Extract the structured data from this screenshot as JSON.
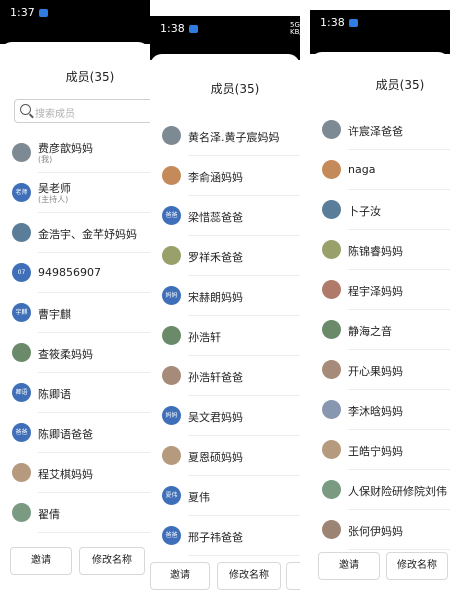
{
  "screens": [
    {
      "time": "1:37",
      "title": "成员(35)",
      "search_placeholder": "搜索成员",
      "buttons": [
        "邀请",
        "修改名称"
      ],
      "members": [
        {
          "name": "费彦歆妈妈",
          "sub": "(我)",
          "avatar": "",
          "kind": "photo"
        },
        {
          "name": "吴老师",
          "sub": "(主持人)",
          "avatar": "老师",
          "kind": "tag"
        },
        {
          "name": "金浩宇、金芊妤妈妈",
          "sub": "",
          "avatar": "",
          "kind": "photo"
        },
        {
          "name": "949856907",
          "sub": "",
          "avatar": "07",
          "kind": "tag"
        },
        {
          "name": "曹宇麒",
          "sub": "",
          "avatar": "宇麒",
          "kind": "tag"
        },
        {
          "name": "查筱柔妈妈",
          "sub": "",
          "avatar": "",
          "kind": "photo"
        },
        {
          "name": "陈卿语",
          "sub": "",
          "avatar": "卿语",
          "kind": "tag"
        },
        {
          "name": "陈卿语爸爸",
          "sub": "",
          "avatar": "爸爸",
          "kind": "tag"
        },
        {
          "name": "程艾棋妈妈",
          "sub": "",
          "avatar": "",
          "kind": "photo"
        },
        {
          "name": "翟倩",
          "sub": "",
          "avatar": "",
          "kind": "photo"
        }
      ]
    },
    {
      "time": "1:38",
      "title": "成员(35)",
      "status_right": [
        "5G",
        "KB/s"
      ],
      "buttons": [
        "邀请",
        "修改名称"
      ],
      "members": [
        {
          "name": "黄名泽.黄子宸妈妈",
          "avatar": "",
          "kind": "photo"
        },
        {
          "name": "李俞涵妈妈",
          "avatar": "",
          "kind": "photo"
        },
        {
          "name": "梁惜蕊爸爸",
          "avatar": "爸爸",
          "kind": "tag"
        },
        {
          "name": "罗祥禾爸爸",
          "avatar": "",
          "kind": "photo"
        },
        {
          "name": "宋赫朗妈妈",
          "avatar": "妈妈",
          "kind": "tag"
        },
        {
          "name": "孙浩轩",
          "avatar": "",
          "kind": "photo"
        },
        {
          "name": "孙浩轩爸爸",
          "avatar": "",
          "kind": "photo"
        },
        {
          "name": "吴文君妈妈",
          "avatar": "妈妈",
          "kind": "tag"
        },
        {
          "name": "夏恩硕妈妈",
          "avatar": "",
          "kind": "photo"
        },
        {
          "name": "夏伟",
          "avatar": "夏伟",
          "kind": "tag"
        },
        {
          "name": "邢子祎爸爸",
          "avatar": "爸爸",
          "kind": "tag"
        }
      ]
    },
    {
      "time": "1:38",
      "title": "成员(35)",
      "buttons": [
        "邀请",
        "修改名称"
      ],
      "members": [
        {
          "name": "许宸泽爸爸",
          "avatar": "",
          "kind": "photo"
        },
        {
          "name": "naga",
          "avatar": "",
          "kind": "photo"
        },
        {
          "name": "卜子汝",
          "avatar": "",
          "kind": "photo"
        },
        {
          "name": "陈锦睿妈妈",
          "avatar": "",
          "kind": "photo"
        },
        {
          "name": "程宇泽妈妈",
          "avatar": "",
          "kind": "photo"
        },
        {
          "name": "静海之音",
          "avatar": "",
          "kind": "photo"
        },
        {
          "name": "开心果妈妈",
          "avatar": "",
          "kind": "photo"
        },
        {
          "name": "李沐晗妈妈",
          "avatar": "",
          "kind": "photo"
        },
        {
          "name": "王皓宁妈妈",
          "avatar": "",
          "kind": "photo"
        },
        {
          "name": "人保财险研修院刘伟",
          "avatar": "",
          "kind": "photo"
        },
        {
          "name": "张何伊妈妈",
          "avatar": "",
          "kind": "photo"
        }
      ]
    }
  ],
  "colors": {
    "accent": "#3e6fb8",
    "statusbar": "#000000",
    "status_indicator": "#2f7de1"
  }
}
